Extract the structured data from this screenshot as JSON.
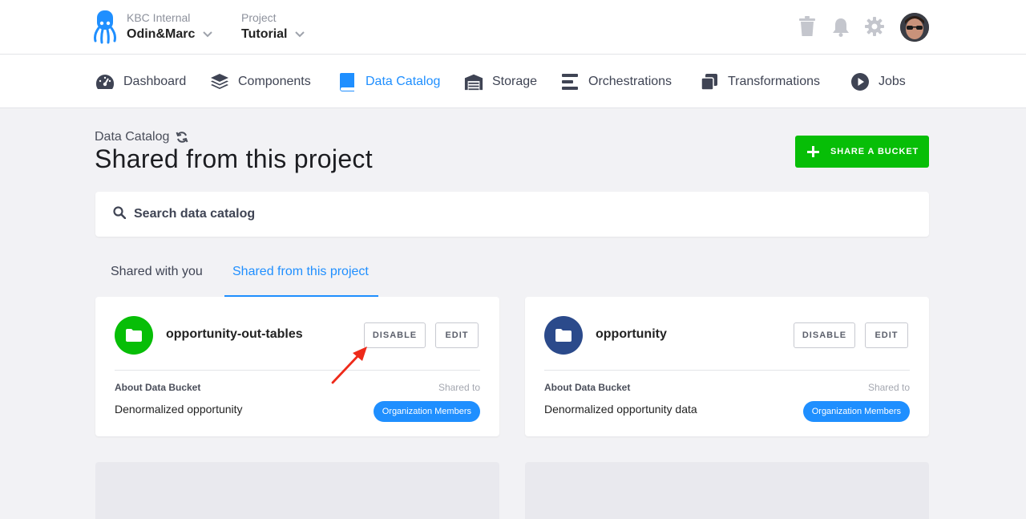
{
  "header": {
    "org_label": "KBC Internal",
    "org_value": "Odin&Marc",
    "project_label": "Project",
    "project_value": "Tutorial",
    "icons": [
      "trash-icon",
      "bell-icon",
      "gear-icon"
    ]
  },
  "nav": {
    "items": [
      {
        "label": "Dashboard",
        "icon": "dashboard-icon"
      },
      {
        "label": "Components",
        "icon": "layers-icon"
      },
      {
        "label": "Data Catalog",
        "icon": "book-icon",
        "active": true
      },
      {
        "label": "Storage",
        "icon": "warehouse-icon"
      },
      {
        "label": "Orchestrations",
        "icon": "bars-icon"
      },
      {
        "label": "Transformations",
        "icon": "copy-icon"
      },
      {
        "label": "Jobs",
        "icon": "play-icon"
      }
    ]
  },
  "page": {
    "breadcrumb": "Data Catalog",
    "title": "Shared from this project",
    "share_button": "SHARE A BUCKET"
  },
  "search": {
    "placeholder": "Search data catalog"
  },
  "tabs": [
    {
      "label": "Shared with you",
      "active": false
    },
    {
      "label": "Shared from this project",
      "active": true
    }
  ],
  "buckets": [
    {
      "name": "opportunity-out-tables",
      "icon_color": "#07be07",
      "disable_label": "DISABLE",
      "edit_label": "EDIT",
      "about_label": "About Data Bucket",
      "shared_to_label": "Shared to",
      "description": "Denormalized opportunity",
      "shared_to": "Organization Members"
    },
    {
      "name": "opportunity",
      "icon_color": "#2b4a8b",
      "disable_label": "DISABLE",
      "edit_label": "EDIT",
      "about_label": "About Data Bucket",
      "shared_to_label": "Shared to",
      "description": "Denormalized opportunity data",
      "shared_to": "Organization Members"
    }
  ],
  "colors": {
    "accent": "#1f8fff",
    "success": "#07be07",
    "annotation_arrow": "#ee2a1a"
  }
}
